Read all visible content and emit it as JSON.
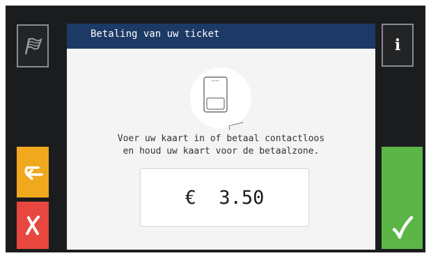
{
  "header": {
    "title": "Betaling van uw ticket"
  },
  "instruction": {
    "line1": "Voer uw kaart in of betaal contactloos",
    "line2": "en houd uw kaart voor de betaalzone."
  },
  "payment": {
    "currency": "€",
    "amount": "3.50"
  },
  "buttons": {
    "language": {
      "icon": "flag-icon"
    },
    "info": {
      "icon": "info-icon",
      "label": "i"
    },
    "back": {
      "icon": "back-arrow-icon",
      "color": "#f0a81f"
    },
    "cancel": {
      "icon": "x-icon",
      "color": "#e8473f"
    },
    "confirm": {
      "icon": "checkmark-icon",
      "color": "#5cb547"
    }
  },
  "colors": {
    "header_bg": "#1d3a66",
    "panel_bg": "#f4f4f4",
    "screen_bg": "#1b1c1e"
  }
}
